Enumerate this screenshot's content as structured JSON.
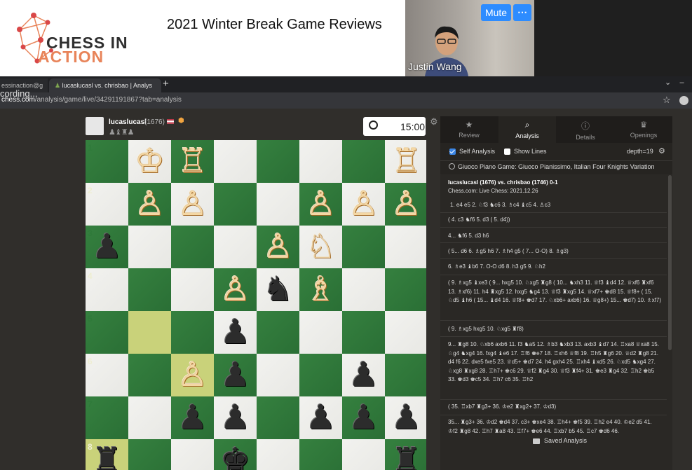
{
  "banner": {
    "logo_text_top": "CHESS IN",
    "logo_text_bottom": "ACTION",
    "title": "2021 Winter Break Game Reviews"
  },
  "video": {
    "participant_name": "Justin Wang",
    "mute_label": "Mute",
    "more_label": "⋯"
  },
  "browser": {
    "tab1_label": "essinaction@g",
    "tab2_label": "lucaslucasl vs. chrisbao | Analys",
    "recording_label": "cording...",
    "url_prefix": "chess.com",
    "url_path": "/analysis/game/live/34291191867?tab=analysis"
  },
  "player": {
    "name": "lucaslucasl",
    "rating": "(1676)",
    "captured": "♟♝♜♟"
  },
  "clock": {
    "time": "15:00"
  },
  "board": {
    "ranks": [
      "1",
      "2",
      "3",
      "4",
      "5",
      "6",
      "7",
      "8"
    ],
    "pieces": [
      {
        "sym": "♔",
        "c": "w"
      },
      {
        "sym": "♖",
        "c": "w"
      },
      {
        "sym": "♖",
        "c": "w"
      },
      {
        "sym": "♙",
        "c": "w"
      },
      {
        "sym": "♙",
        "c": "w"
      },
      {
        "sym": "♙",
        "c": "w"
      },
      {
        "sym": "♙",
        "c": "w"
      },
      {
        "sym": "♙",
        "c": "w"
      },
      {
        "sym": "♟",
        "c": "b"
      },
      {
        "sym": "♙",
        "c": "w"
      },
      {
        "sym": "♘",
        "c": "w"
      },
      {
        "sym": "♙",
        "c": "w"
      },
      {
        "sym": "♞",
        "c": "b"
      },
      {
        "sym": "♗",
        "c": "w"
      },
      {
        "sym": "♟",
        "c": "b"
      },
      {
        "sym": "♙",
        "c": "w"
      },
      {
        "sym": "♟",
        "c": "b"
      },
      {
        "sym": "♟",
        "c": "b"
      },
      {
        "sym": "♟",
        "c": "b"
      },
      {
        "sym": "♟",
        "c": "b"
      },
      {
        "sym": "♟",
        "c": "b"
      },
      {
        "sym": "♟",
        "c": "b"
      },
      {
        "sym": "♟",
        "c": "b"
      },
      {
        "sym": "♜",
        "c": "b"
      },
      {
        "sym": "♚",
        "c": "b"
      },
      {
        "sym": "♜",
        "c": "b"
      }
    ]
  },
  "panel": {
    "tabs": [
      {
        "icon": "★",
        "label": "Review"
      },
      {
        "icon": "⌕",
        "label": "Analysis"
      },
      {
        "icon": "ⓘ",
        "label": "Details"
      },
      {
        "icon": "♛",
        "label": "Openings"
      }
    ],
    "self_analysis": "Self Analysis",
    "show_lines": "Show Lines",
    "depth": "depth=19",
    "opening": "Giuoco Piano Game: Giuoco Pianissimo, Italian Four Knights Variation",
    "header_players": "lucaslucasl (1676) vs. chrisbao (1746) 0-1",
    "header_site": "Chess.com: Live Chess: 2021.12.26",
    "moves": [
      "1. e4 e5 2. ♘f3 ♞c6 3. ♗c4 ♝c5 4. ♙c3",
      "( 4. c3 ♞f6 5. d3 ( 5. d4))",
      "4... ♞f6 5. d3 h6",
      "( 5... d6 6. ♗g5 h6 7. ♗h4 g5 ( 7... O-O) 8. ♗g3)",
      "6. ♗e3 ♝b6 7. O-O d6 8. h3 g5 9. ♘h2",
      "( 9. ♗xg5 ♝xe3 ( 9... hxg5 10. ♘xg5 ♜g8 ( 10... ♞xh3 11. ♕f3 ♝d4 12. ♕xf6 ♜xf6 13. ♗xf6) 11. h4 ♜xg5 12. hxg5 ♞g4 13. ♕f3 ♜xg5 14. ♕xf7+ ♚d8 15. ♕f8+ ( 15. ♘d5 ♝h6 ( 15... ♝d4 16. ♕f8+ ♚d7 17. ♘xb6+ axb6) 16. ♕g8+) 15... ♚d7) 10. ♗xf7)",
      "( 9. ♗xg5 hxg5 10. ♘xg5 ♜f8)",
      "9... ♜g8 10. ♘xb6 axb6 11. f3 ♞a5 12. ♗b3 ♞xb3 13. axb3 ♝d7 14. ♖xa8 ♕xa8 15. ♘g4 ♞xg4 16. fxg4 ♝e6 17. ♖f6 ♚e7 18. ♖xh6 ♕f8 19. ♖h5 ♜g6 20. ♕d2 ♜g8 21. d4 f6 22. dxe5 fxe5 23. ♕d5+ ♚d7 24. h4 gxh4 25. ♖xh4 ♝xd5 26. ♘xd5 ♞xg4 27. ♘xg8 ♜xg8 28. ♖h7+ ♚c6 29. ♕f2 ♜g4 30. ♕f3 ♜f4+ 31. ♚e3 ♜g4 32. ♖h2 ♚b5 33. ♚d3 ♚c5 34. ♖h7 c6 35. ♖h2",
      "( 35. ♖xb7 ♜g3+ 36. ♔e2 ♜xg2+ 37. ♔d3)",
      "35... ♜g3+ 36. ♔d2 ♚d4 37. c3+ ♚xe4 38. ♖h4+ ♚f5 39. ♖h2 e4 40. ♔e2 d5 41. ♔f2 ♜g8 42. ♖h7 ♜a8 43. ♖f7+ ♚e6 44. ♖xb7 b5 45. ♖c7 ♚d6 46."
    ],
    "saved_analysis": "Saved Analysis"
  }
}
